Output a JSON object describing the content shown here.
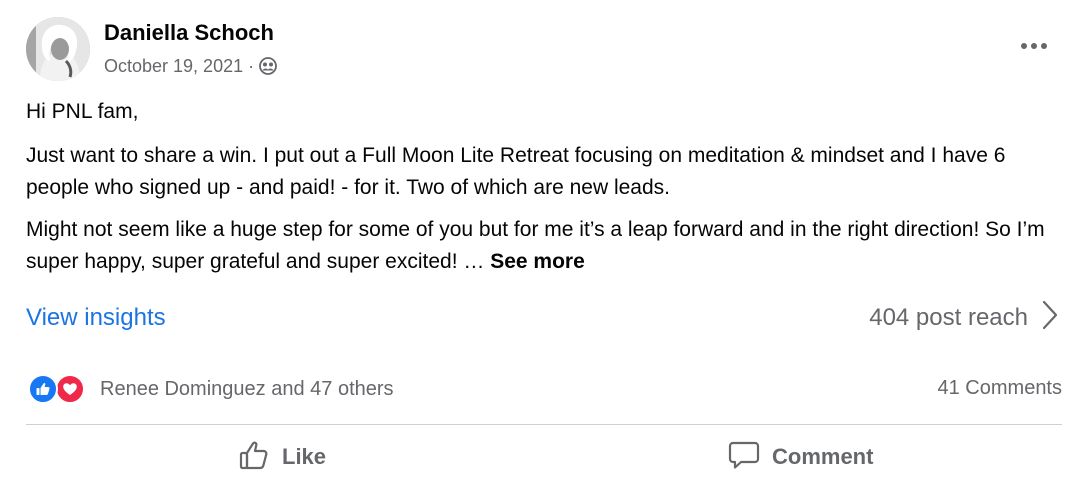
{
  "post": {
    "author": "Daniella Schoch",
    "date": "October 19, 2021",
    "separator": "·",
    "paragraphs": [
      "Hi PNL fam,",
      "Just want to share a win. I put out a Full Moon Lite Retreat focusing on meditation & mindset and I have 6 people who signed up - and paid! - for it. Two of which are new leads.",
      "Might not seem like a huge step for some of you but for me it’s a leap forward and in the right direction! So I’m super happy, super grateful and super excited! … "
    ],
    "see_more": "See more",
    "insights_label": "View insights",
    "reach_label": "404 post reach",
    "reactions_text": "Renee Dominguez and 47 others",
    "comments_count": "41 Comments",
    "actions": {
      "like": "Like",
      "comment": "Comment"
    }
  },
  "icons": {
    "audience": "group-audience-icon",
    "more": "more-options-icon",
    "reach_chevron": "chevron-right-icon",
    "reaction_like": "like-reaction-icon",
    "reaction_love": "love-reaction-icon",
    "action_like": "thumbs-up-icon",
    "action_comment": "comment-bubble-icon"
  },
  "colors": {
    "link": "#1b74e4",
    "secondary_text": "#65676b",
    "like_blue": "#1877f2",
    "love_red": "#f02849",
    "divider": "#ced0d4"
  }
}
